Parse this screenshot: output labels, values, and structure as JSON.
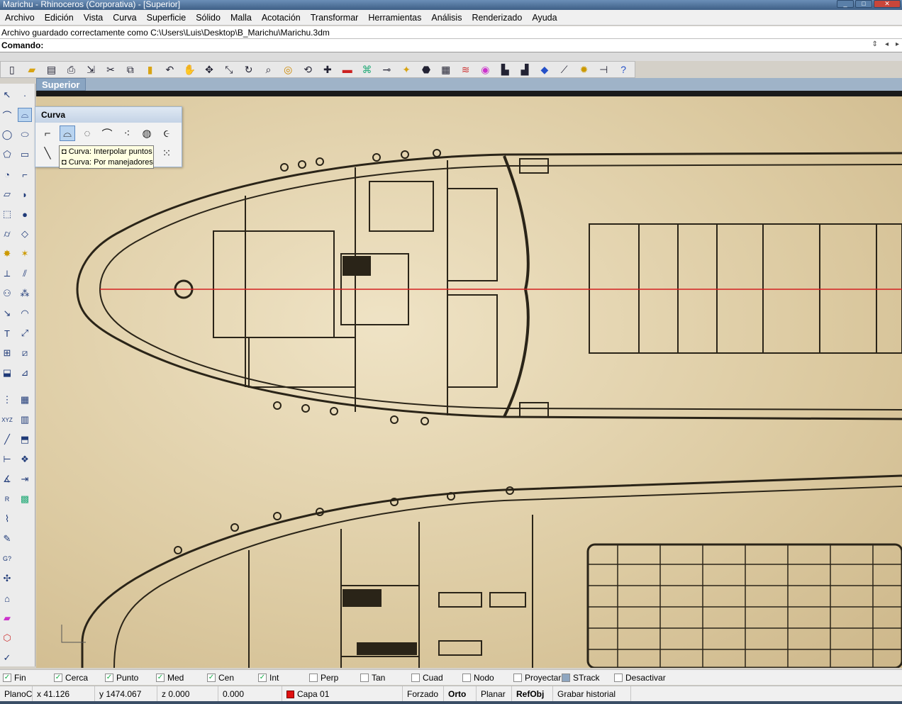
{
  "window": {
    "title": "Marichu - Rhinoceros (Corporativa) - [Superior]"
  },
  "menu": [
    "Archivo",
    "Edición",
    "Vista",
    "Curva",
    "Superficie",
    "Sólido",
    "Malla",
    "Acotación",
    "Transformar",
    "Herramientas",
    "Análisis",
    "Renderizado",
    "Ayuda"
  ],
  "history": {
    "text": "Archivo guardado correctamente como C:\\Users\\Luis\\Desktop\\B_Marichu\\Marichu.3dm"
  },
  "command": {
    "label": "Comando:"
  },
  "viewport": {
    "name": "Superior"
  },
  "popup": {
    "title": "Curva"
  },
  "tooltip": {
    "line1": "Curva: Interpolar puntos",
    "line2": "Curva: Por manejadores"
  },
  "osnap": [
    {
      "label": "Fin",
      "checked": true
    },
    {
      "label": "Cerca",
      "checked": true
    },
    {
      "label": "Punto",
      "checked": true
    },
    {
      "label": "Med",
      "checked": true
    },
    {
      "label": "Cen",
      "checked": true
    },
    {
      "label": "Int",
      "checked": true
    },
    {
      "label": "Perp",
      "checked": false
    },
    {
      "label": "Tan",
      "checked": false
    },
    {
      "label": "Cuad",
      "checked": false
    },
    {
      "label": "Nodo",
      "checked": false
    },
    {
      "label": "Proyectar",
      "checked": false
    },
    {
      "label": "STrack",
      "checked": false
    },
    {
      "label": "Desactivar",
      "checked": false
    }
  ],
  "status": {
    "cplane": "PlanoC",
    "x": "x 41.126",
    "y": "y 1474.067",
    "z": "z 0.000",
    "dist": "0.000",
    "layer": "Capa 01",
    "layer_color": "#e01010",
    "forzado": "Forzado",
    "orto": "Orto",
    "planar": "Planar",
    "refobj": "RefObj",
    "history": "Grabar historial"
  }
}
